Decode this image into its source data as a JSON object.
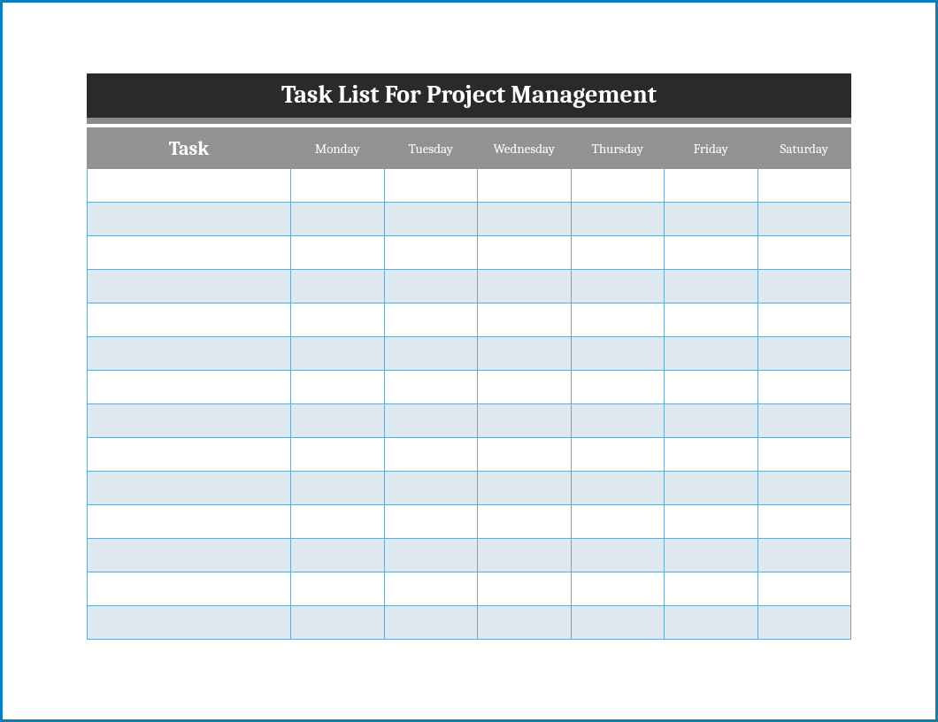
{
  "title": "Task List For Project Management",
  "columns": {
    "task": "Task",
    "monday": "Monday",
    "tuesday": "Tuesday",
    "wednesday": "Wednesday",
    "thursday": "Thursday",
    "friday": "Friday",
    "saturday": "Saturday"
  },
  "rows": [
    {
      "task": "",
      "monday": "",
      "tuesday": "",
      "wednesday": "",
      "thursday": "",
      "friday": "",
      "saturday": ""
    },
    {
      "task": "",
      "monday": "",
      "tuesday": "",
      "wednesday": "",
      "thursday": "",
      "friday": "",
      "saturday": ""
    },
    {
      "task": "",
      "monday": "",
      "tuesday": "",
      "wednesday": "",
      "thursday": "",
      "friday": "",
      "saturday": ""
    },
    {
      "task": "",
      "monday": "",
      "tuesday": "",
      "wednesday": "",
      "thursday": "",
      "friday": "",
      "saturday": ""
    },
    {
      "task": "",
      "monday": "",
      "tuesday": "",
      "wednesday": "",
      "thursday": "",
      "friday": "",
      "saturday": ""
    },
    {
      "task": "",
      "monday": "",
      "tuesday": "",
      "wednesday": "",
      "thursday": "",
      "friday": "",
      "saturday": ""
    },
    {
      "task": "",
      "monday": "",
      "tuesday": "",
      "wednesday": "",
      "thursday": "",
      "friday": "",
      "saturday": ""
    },
    {
      "task": "",
      "monday": "",
      "tuesday": "",
      "wednesday": "",
      "thursday": "",
      "friday": "",
      "saturday": ""
    },
    {
      "task": "",
      "monday": "",
      "tuesday": "",
      "wednesday": "",
      "thursday": "",
      "friday": "",
      "saturday": ""
    },
    {
      "task": "",
      "monday": "",
      "tuesday": "",
      "wednesday": "",
      "thursday": "",
      "friday": "",
      "saturday": ""
    },
    {
      "task": "",
      "monday": "",
      "tuesday": "",
      "wednesday": "",
      "thursday": "",
      "friday": "",
      "saturday": ""
    },
    {
      "task": "",
      "monday": "",
      "tuesday": "",
      "wednesday": "",
      "thursday": "",
      "friday": "",
      "saturday": ""
    },
    {
      "task": "",
      "monday": "",
      "tuesday": "",
      "wednesday": "",
      "thursday": "",
      "friday": "",
      "saturday": ""
    },
    {
      "task": "",
      "monday": "",
      "tuesday": "",
      "wednesday": "",
      "thursday": "",
      "friday": "",
      "saturday": ""
    }
  ]
}
